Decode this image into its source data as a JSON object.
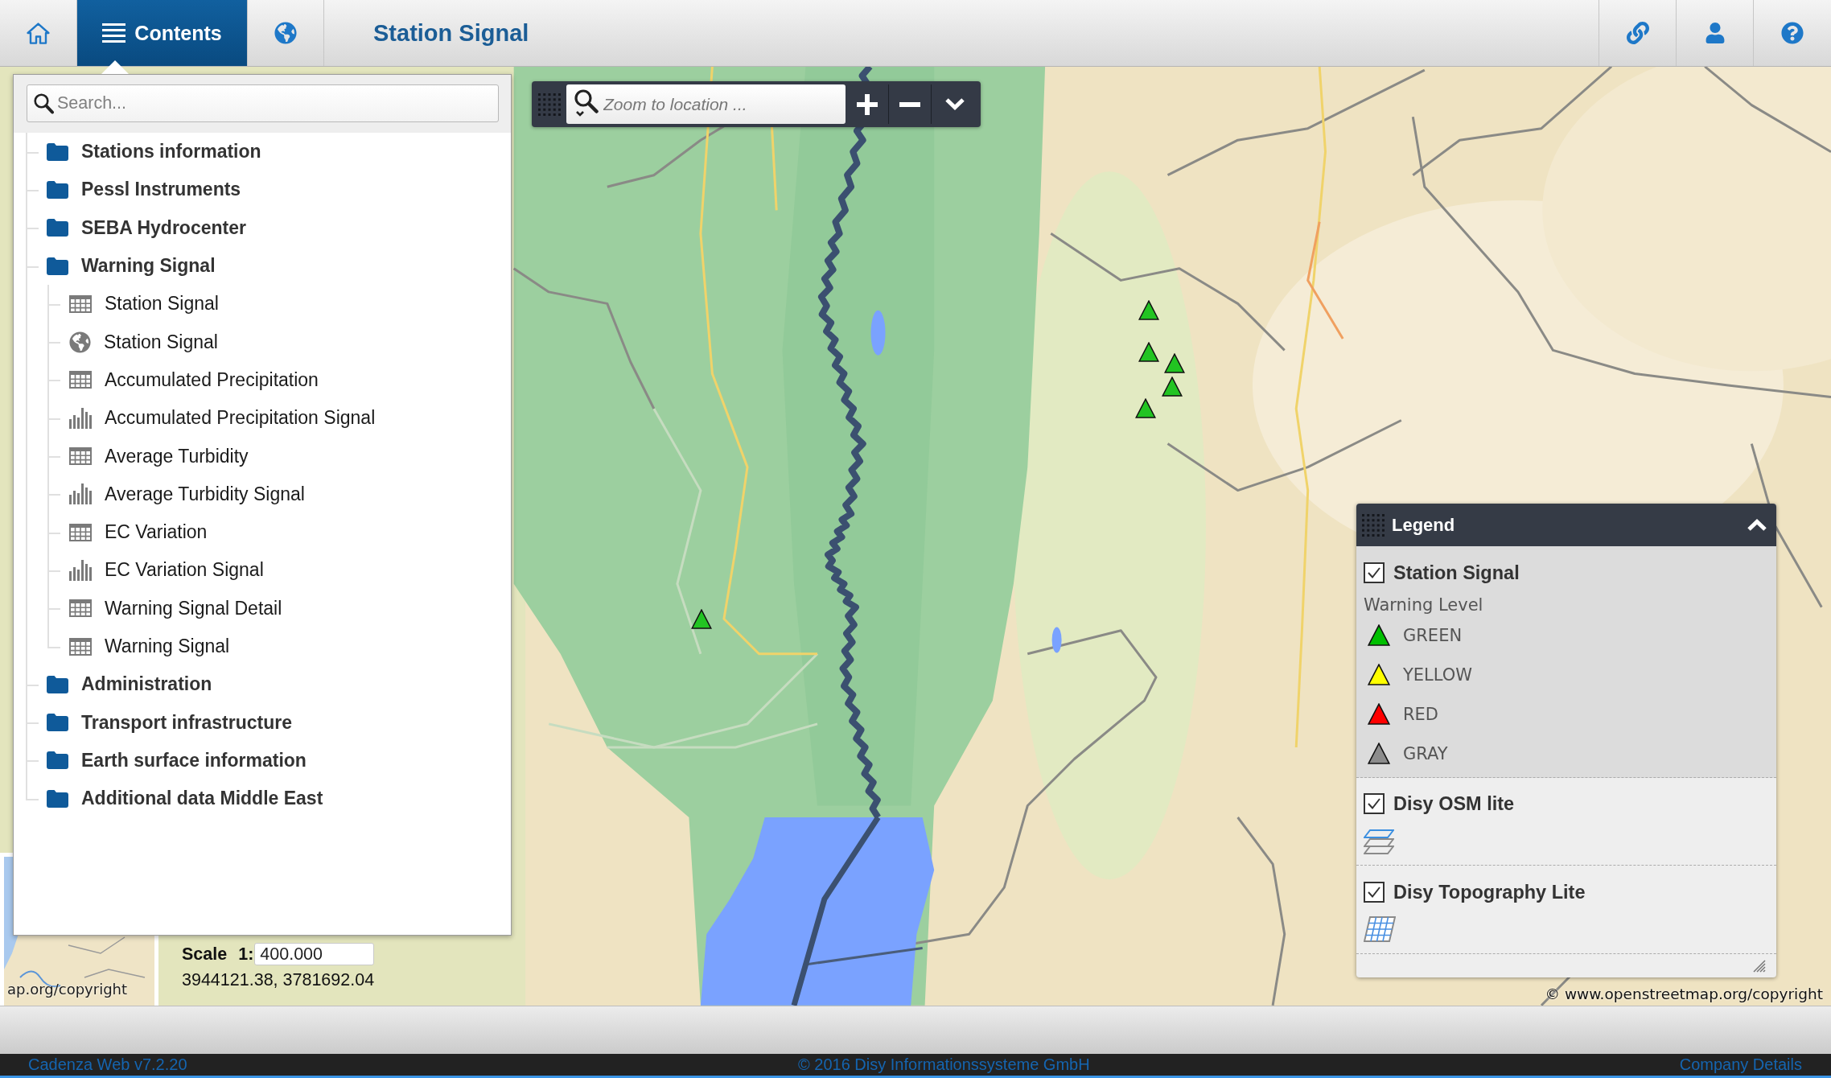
{
  "topbar": {
    "buttons": [
      {
        "kind": "home",
        "selected": false
      },
      {
        "kind": "contents",
        "label": "Contents",
        "selected": true
      },
      {
        "kind": "globe",
        "selected": false
      }
    ],
    "title": "Station Signal",
    "tools": [
      {
        "kind": "link"
      },
      {
        "kind": "user"
      },
      {
        "kind": "help"
      }
    ]
  },
  "contents_panel": {
    "search": {
      "placeholder": "Search..."
    },
    "tree": [
      {
        "kind": "folder",
        "label": "Stations information"
      },
      {
        "kind": "folder",
        "label": "Pessl Instruments"
      },
      {
        "kind": "folder",
        "label": "SEBA Hydrocenter"
      },
      {
        "kind": "folder",
        "label": "Warning Signal",
        "children": [
          {
            "kind": "table",
            "label": "Station Signal"
          },
          {
            "kind": "map",
            "label": "Station Signal"
          },
          {
            "kind": "table",
            "label": "Accumulated Precipitation"
          },
          {
            "kind": "chart",
            "label": "Accumulated Precipitation Signal"
          },
          {
            "kind": "table",
            "label": "Average Turbidity"
          },
          {
            "kind": "chart",
            "label": "Average Turbidity Signal"
          },
          {
            "kind": "table",
            "label": "EC Variation"
          },
          {
            "kind": "chart",
            "label": "EC Variation Signal"
          },
          {
            "kind": "table",
            "label": "Warning Signal Detail"
          },
          {
            "kind": "table",
            "label": "Warning Signal"
          }
        ]
      },
      {
        "kind": "folder",
        "label": "Administration"
      },
      {
        "kind": "folder",
        "label": "Transport infrastructure"
      },
      {
        "kind": "folder",
        "label": "Earth surface information"
      },
      {
        "kind": "folder",
        "label": "Additional data Middle East"
      }
    ]
  },
  "zoom_toolbar": {
    "search": {
      "placeholder": "Zoom to location ..."
    },
    "buttons": [
      {
        "kind": "zoom_in"
      },
      {
        "kind": "zoom_out"
      },
      {
        "kind": "menu"
      }
    ]
  },
  "map": {
    "markers": [
      {
        "color": "#22c422"
      },
      {
        "color": "#22c422"
      },
      {
        "color": "#22c422"
      },
      {
        "color": "#22c422"
      },
      {
        "color": "#22c422"
      },
      {
        "color": "#22c422"
      }
    ],
    "scale": {
      "label": "Scale",
      "prefix": "1:",
      "value": "400.000"
    },
    "coordinates": "3944121.38, 3781692.04",
    "attribution": "© www.openstreetmap.org/copyright",
    "overview": {
      "attribution": "ap.org/copyright"
    }
  },
  "legend": {
    "title": "Legend",
    "expanded": true,
    "layers": [
      {
        "kind": "symbols",
        "name": "Station Signal",
        "checked": true,
        "highlighted": true,
        "caption": "Warning Level",
        "classes": [
          {
            "label": "GREEN",
            "color": "#00c000"
          },
          {
            "label": "YELLOW",
            "color": "#ffff00"
          },
          {
            "label": "RED",
            "color": "#ff0000"
          },
          {
            "label": "GRAY",
            "color": "#8c8c8c"
          }
        ]
      },
      {
        "kind": "tiles",
        "name": "Disy OSM lite",
        "checked": true,
        "highlighted": false
      },
      {
        "kind": "grid",
        "name": "Disy Topography Lite",
        "checked": true,
        "highlighted": false
      }
    ]
  },
  "footer": {
    "version": "Cadenza Web v7.2.20",
    "copyright": "© 2016 Disy Informationssysteme GmbH",
    "link": "Company Details"
  }
}
